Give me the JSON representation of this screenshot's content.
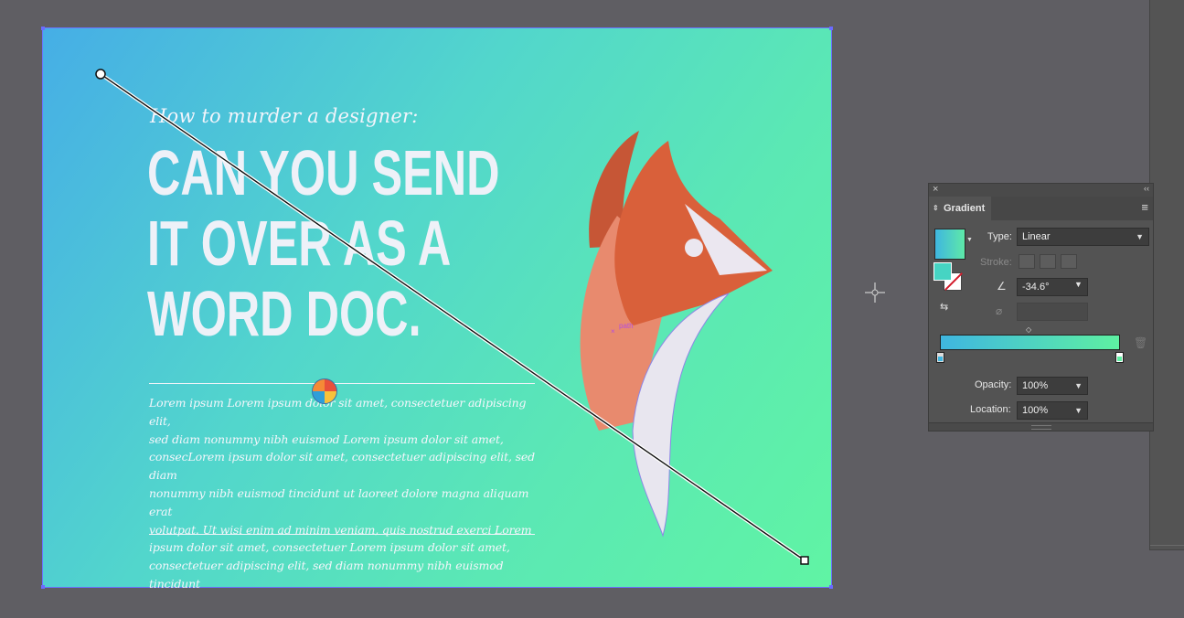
{
  "artboard": {
    "eyebrow": "How to murder a designer:",
    "headline": [
      "CAN YOU SEND",
      "IT OVER AS A",
      "WORD DOC."
    ],
    "body_lines": [
      "Lorem ipsum Lorem ipsum dolor sit amet, consectetuer adipiscing elit,",
      "sed diam nonummy nibh euismod Lorem ipsum dolor sit amet,",
      "consecLorem ipsum dolor sit amet, consectetuer adipiscing elit, sed diam",
      "nonummy nibh euismod tincidunt ut laoreet dolore magna aliquam erat",
      "volutpat. Ut wisi enim ad minim veniam, quis nostrud exerci Lorem",
      "ipsum dolor sit amet, consectetuer Lorem ipsum dolor sit amet,",
      "consectetuer adipiscing elit, sed diam nonummy nibh euismod tincidunt"
    ],
    "path_label": "path",
    "gradient_colors": {
      "start": "#46aee6",
      "end": "#60f4a4"
    },
    "bird_colors": {
      "dark": "#c65636",
      "mid": "#d9603a",
      "light": "#e88a6e",
      "belly": "#e8e6ef"
    }
  },
  "gradient_panel": {
    "close": "×",
    "collapse": "‹‹",
    "tab_arrows": "⇕",
    "tab_label": "Gradient",
    "menu_icon": "menu-icon",
    "type_label": "Type:",
    "type_value": "Linear",
    "stroke_label": "Stroke:",
    "angle_value": "-34.6°",
    "opacity_label": "Opacity:",
    "opacity_value": "100%",
    "location_label": "Location:",
    "location_value": "100%",
    "colors": {
      "start": "#3fb6e0",
      "end": "#5ef0a2"
    }
  }
}
